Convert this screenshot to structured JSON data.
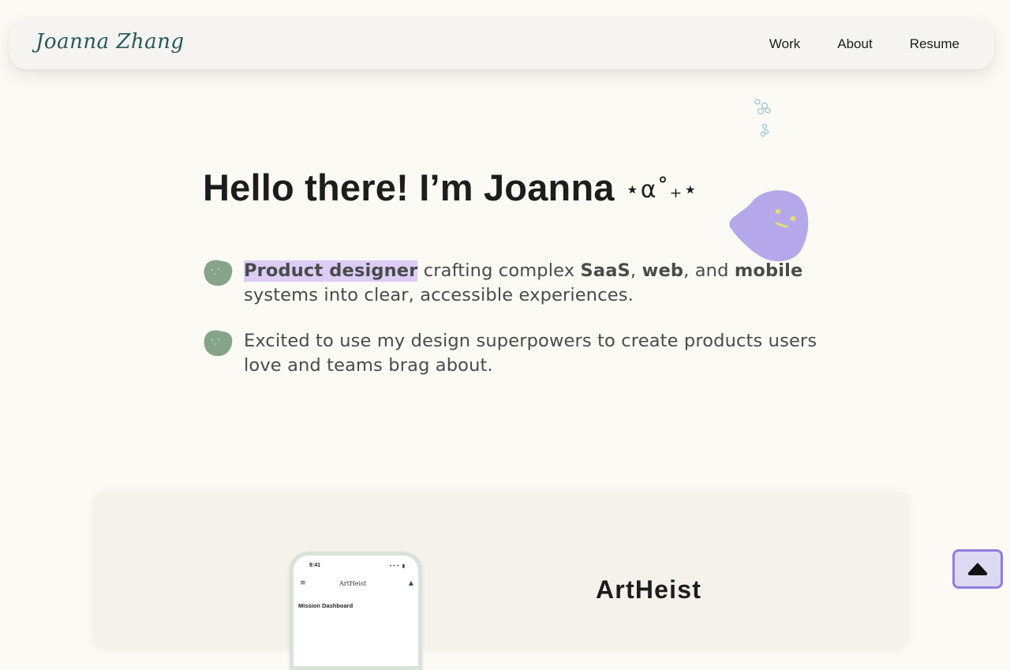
{
  "header": {
    "logo": "Joanna Zhang",
    "nav": [
      "Work",
      "About",
      "Resume"
    ]
  },
  "hero": {
    "title": "Hello there! I’m Joanna",
    "sparkle": "⋆⍺˚₊⋆",
    "bullet1": {
      "highlight": "Product designer",
      "text1": " crafting complex ",
      "b1": "SaaS",
      "text2": ", ",
      "b2": "web",
      "text3": ", and ",
      "b3": "mobile",
      "text4": " systems into clear, accessible experiences."
    },
    "bullet2": "Excited to use my design superpowers to create products users love and teams brag about."
  },
  "project": {
    "title": "ArtHeist",
    "phone": {
      "time": "9:41",
      "status": "••• ▮",
      "menu": "≡",
      "brand": "ArtHeist",
      "bell": "▲",
      "section": "Mission Dashboard"
    }
  },
  "icons": {
    "scroll_top": "triangle-up-icon",
    "blob": "blob-face-icon",
    "bubbles": "bubbles-icon"
  },
  "colors": {
    "background": "#fbfaf4",
    "accent_purple": "#b5a8ea",
    "highlight": "#dccdf6",
    "blob_green": "#86a48a",
    "logo": "#27585a",
    "scroll_button_border": "#8d7fe0"
  }
}
